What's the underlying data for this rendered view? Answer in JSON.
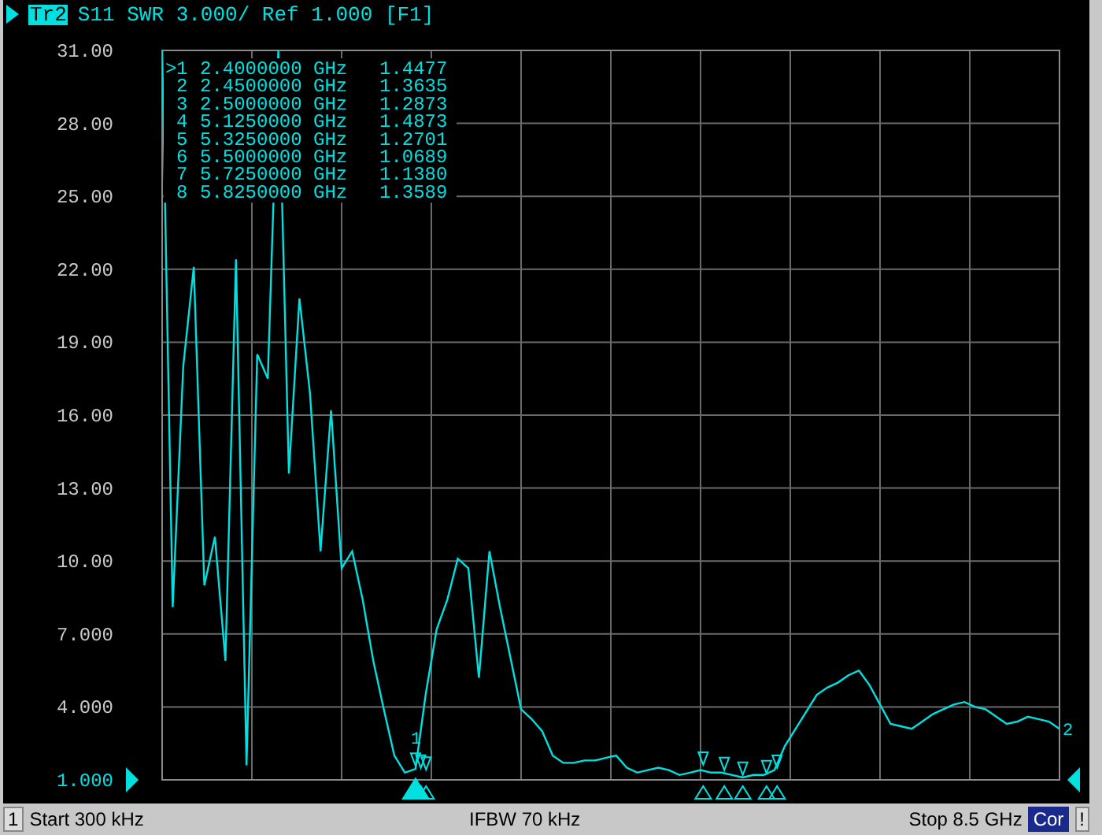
{
  "header": {
    "trace": "Tr2",
    "text": "S11 SWR 3.000/ Ref 1.000 [F1]"
  },
  "chart": {
    "trace_number": "2",
    "chart_data": {
      "type": "line",
      "categories": [
        null,
        null,
        null,
        null,
        null,
        null,
        null,
        null,
        null,
        null,
        null,
        null,
        null,
        null,
        null,
        null,
        null,
        null,
        null,
        null,
        null,
        null,
        null,
        null,
        null,
        null,
        null,
        null,
        null,
        null,
        null,
        null,
        null,
        null,
        null,
        null,
        null,
        null,
        null,
        null,
        null,
        null,
        null,
        null,
        null,
        null,
        null,
        null,
        null,
        null,
        null,
        null,
        null,
        null,
        null,
        null,
        null,
        null,
        null,
        null,
        null,
        null,
        null,
        null,
        null,
        null,
        null,
        null,
        null,
        null,
        null,
        null,
        null,
        null,
        null,
        null,
        null,
        null,
        null,
        null,
        null,
        null,
        null,
        null,
        null,
        null
      ],
      "series": [
        {
          "color": "#00e0e0",
          "values": [
            31,
            8.1,
            18,
            22.1,
            9,
            11,
            5.9,
            22.4,
            1.6,
            18.5,
            17.5,
            31,
            13.6,
            20.8,
            16.9,
            10.4,
            16.2,
            9.7,
            10.4,
            8.4,
            5.9,
            3.9,
            2.0,
            1.3,
            1.45,
            4.6,
            7.2,
            8.4,
            10.1,
            9.7,
            5.2,
            10.4,
            8.1,
            6.0,
            3.9,
            3.5,
            3.0,
            2.0,
            1.7,
            1.7,
            1.8,
            1.8,
            1.9,
            2.0,
            1.5,
            1.3,
            1.4,
            1.5,
            1.4,
            1.2,
            1.3,
            1.4,
            1.3,
            1.3,
            1.2,
            1.1,
            1.2,
            1.2,
            1.4,
            2.4,
            3.1,
            3.8,
            4.5,
            4.8,
            5.0,
            5.3,
            5.5,
            4.9,
            4.1,
            3.3,
            3.2,
            3.1,
            3.4,
            3.7,
            3.9,
            4.1,
            4.2,
            4.0,
            3.9,
            3.6,
            3.3,
            3.4,
            3.6,
            3.5,
            3.4,
            3.1
          ]
        }
      ],
      "ylim": [
        1,
        31
      ],
      "grid": true,
      "yticks": [
        {
          "value": 31,
          "label": "31.00"
        },
        {
          "value": 28,
          "label": "28.00"
        },
        {
          "value": 25,
          "label": "25.00"
        },
        {
          "value": 22,
          "label": "22.00"
        },
        {
          "value": 19,
          "label": "19.00"
        },
        {
          "value": 16,
          "label": "16.00"
        },
        {
          "value": 13,
          "label": "13.00"
        },
        {
          "value": 10,
          "label": "10.00"
        },
        {
          "value": 7,
          "label": "7.000"
        },
        {
          "value": 4,
          "label": "4.000"
        },
        {
          "value": 1,
          "label": "1.000"
        }
      ]
    }
  },
  "markers": [
    {
      "number": "1",
      "trace_label": "1",
      "pointer": ">",
      "frequency": "2.4000000 GHz",
      "value": "1.4477",
      "active": true
    },
    {
      "number": "2",
      "frequency": "2.4500000 GHz",
      "value": "1.3635",
      "active": false
    },
    {
      "number": "3",
      "frequency": "2.5000000 GHz",
      "value": "1.2873",
      "active": false
    },
    {
      "number": "4",
      "frequency": "5.1250000 GHz",
      "value": "1.4873",
      "active": false
    },
    {
      "number": "5",
      "frequency": "5.3250000 GHz",
      "value": "1.2701",
      "active": false
    },
    {
      "number": "6",
      "frequency": "5.5000000 GHz",
      "value": "1.0689",
      "active": false
    },
    {
      "number": "7",
      "frequency": "5.7250000 GHz",
      "value": "1.1380",
      "active": false
    },
    {
      "number": "8",
      "frequency": "5.8250000 GHz",
      "value": "1.3589",
      "active": false
    }
  ],
  "status_bar": {
    "channel": "1",
    "start": "Start 300 kHz",
    "ifbw": "IFBW 70 kHz",
    "stop": "Stop 8.5 GHz",
    "correction": "Cor",
    "warning": "!"
  }
}
